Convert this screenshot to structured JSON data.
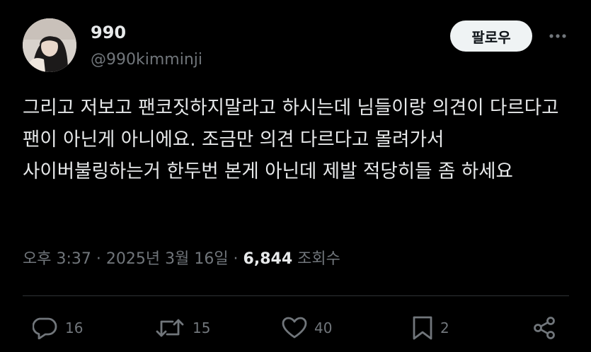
{
  "author": {
    "display_name": "990",
    "handle": "@990kimminji"
  },
  "follow_label": "팔로우",
  "tweet": {
    "text": "그리고 저보고 팬코짓하지말라고 하시는데 님들이랑 의견이 다르다고 팬이 아닌게 아니에요. 조금만 의견 다르다고 몰려가서 사이버불링하는거 한두번 본게 아닌데 제발 적당히들 좀 하세요"
  },
  "meta": {
    "time": "오후 3:37",
    "separator": " · ",
    "date": "2025년 3월 16일",
    "views_count": "6,844",
    "views_label": "조회수"
  },
  "actions": {
    "replies": "16",
    "retweets": "15",
    "likes": "40",
    "bookmarks": "2"
  },
  "icons": [
    "more-icon",
    "reply-icon",
    "retweet-icon",
    "like-icon",
    "bookmark-icon",
    "share-icon"
  ],
  "colors": {
    "background": "#000000",
    "text_primary": "#e7e9ea",
    "text_secondary": "#71767b",
    "divider": "#2f3336",
    "follow_button_bg": "#eff3f4",
    "follow_button_text": "#0f1419"
  }
}
